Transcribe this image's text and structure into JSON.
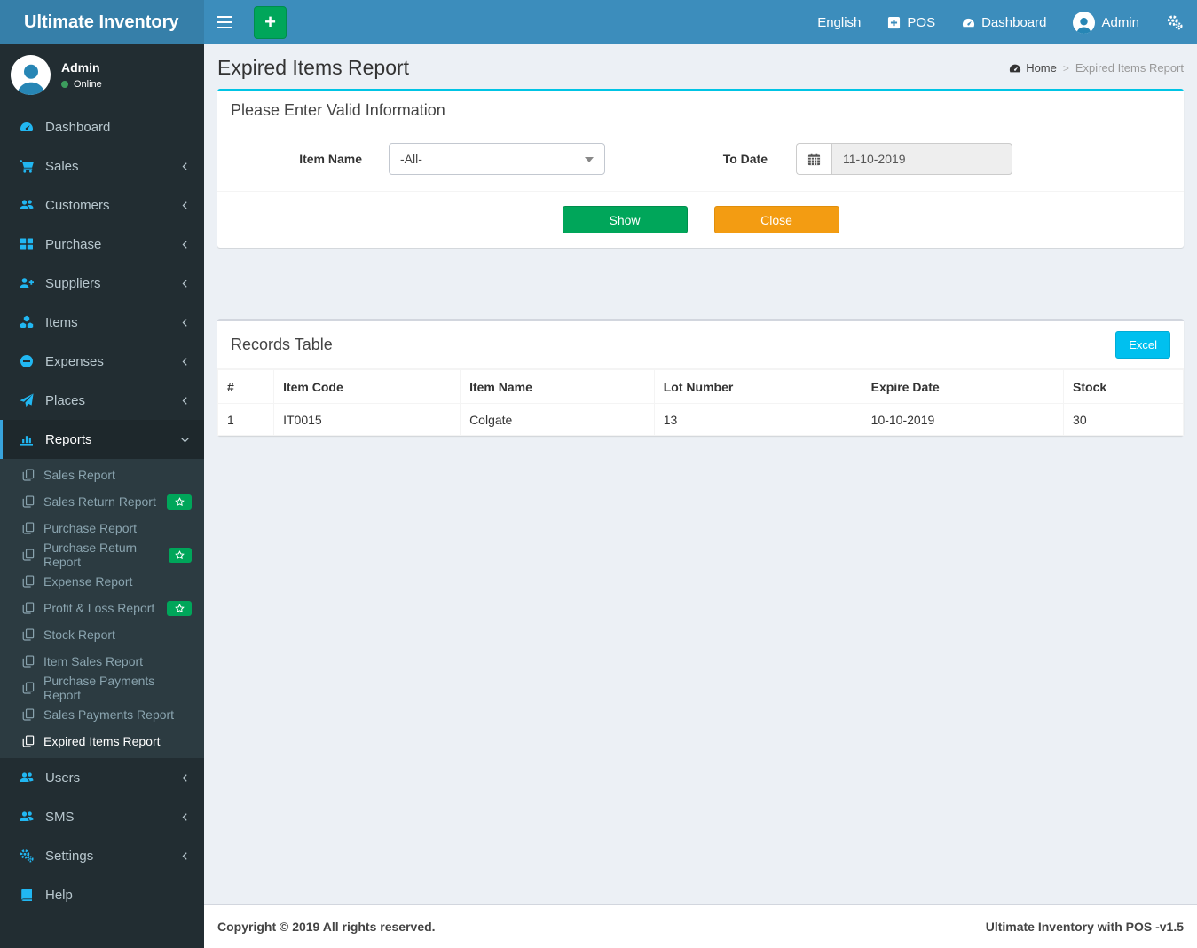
{
  "app": {
    "brand": "Ultimate Inventory"
  },
  "topbar": {
    "language": "English",
    "pos_label": "POS",
    "dashboard_label": "Dashboard",
    "user_name": "Admin",
    "icons": [
      "hamburger-icon",
      "plus-button",
      "plus-square-icon",
      "tachometer-icon",
      "avatar",
      "gears-icon"
    ]
  },
  "sidebar": {
    "user": {
      "name": "Admin",
      "status": "Online"
    },
    "items": [
      {
        "label": "Dashboard",
        "icon": "tachometer-icon",
        "chevron": false
      },
      {
        "label": "Sales",
        "icon": "cart-icon",
        "chevron": true
      },
      {
        "label": "Customers",
        "icon": "users-icon",
        "chevron": true
      },
      {
        "label": "Purchase",
        "icon": "grid-icon",
        "chevron": true
      },
      {
        "label": "Suppliers",
        "icon": "user-plus-icon",
        "chevron": true
      },
      {
        "label": "Items",
        "icon": "cubes-icon",
        "chevron": true
      },
      {
        "label": "Expenses",
        "icon": "minus-circle-icon",
        "chevron": true
      },
      {
        "label": "Places",
        "icon": "send-icon",
        "chevron": true
      },
      {
        "label": "Reports",
        "icon": "bar-chart-icon",
        "chevron": "down",
        "active": true
      }
    ],
    "report_subitems": [
      {
        "label": "Sales Report",
        "badge": false
      },
      {
        "label": "Sales Return Report",
        "badge": true
      },
      {
        "label": "Purchase Report",
        "badge": false
      },
      {
        "label": "Purchase Return Report",
        "badge": true
      },
      {
        "label": "Expense Report",
        "badge": false
      },
      {
        "label": "Profit & Loss Report",
        "badge": true
      },
      {
        "label": "Stock Report",
        "badge": false
      },
      {
        "label": "Item Sales Report",
        "badge": false
      },
      {
        "label": "Purchase Payments Report",
        "badge": false
      },
      {
        "label": "Sales Payments Report",
        "badge": false
      },
      {
        "label": "Expired Items Report",
        "badge": false,
        "active": true
      }
    ],
    "bottom_items": [
      {
        "label": "Users",
        "icon": "users-icon",
        "chevron": true
      },
      {
        "label": "SMS",
        "icon": "users-icon",
        "chevron": true
      },
      {
        "label": "Settings",
        "icon": "gears-icon",
        "chevron": true
      },
      {
        "label": "Help",
        "icon": "book-icon",
        "chevron": false
      }
    ]
  },
  "page": {
    "title": "Expired Items Report",
    "breadcrumb_home": "Home",
    "breadcrumb_sep": ">",
    "breadcrumb_current": "Expired Items Report"
  },
  "filter_panel": {
    "heading": "Please Enter Valid Information",
    "item_name_label": "Item Name",
    "item_name_value": "-All-",
    "to_date_label": "To Date",
    "to_date_value": "11-10-2019",
    "show_label": "Show",
    "close_label": "Close"
  },
  "records_panel": {
    "heading": "Records Table",
    "excel_label": "Excel",
    "table": {
      "headers": [
        "#",
        "Item Code",
        "Item Name",
        "Lot Number",
        "Expire Date",
        "Stock"
      ],
      "rows": [
        [
          "1",
          "IT0015",
          "Colgate",
          "13",
          "10-10-2019",
          "30"
        ]
      ]
    }
  },
  "footer": {
    "left": "Copyright © 2019 All rights reserved.",
    "right": "Ultimate Inventory with POS -v1.5"
  },
  "colors": {
    "navbar": "#3c8dbc",
    "logo_bg": "#367fa9",
    "sidebar_bg": "#222d32",
    "submenu_bg": "#2c3b41",
    "sidebar_text": "#b8c7ce",
    "icon_cyan": "#21b7f2",
    "active_border": "#38a3dc",
    "green": "#00a65a",
    "orange": "#f39c12",
    "excel_cyan": "#00c0ef",
    "panel_top_border": "#00c4e4",
    "content_bg": "#ecf0f5",
    "online_dot": "#3c9d5d"
  }
}
